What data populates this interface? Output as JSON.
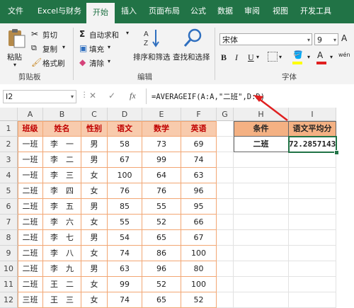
{
  "ribbon_tabs": [
    "文件",
    "Excel与财务",
    "开始",
    "插入",
    "页面布局",
    "公式",
    "数据",
    "审阅",
    "视图",
    "开发工具"
  ],
  "active_tab": "开始",
  "clipboard": {
    "paste": "粘贴",
    "cut": "剪切",
    "copy": "复制",
    "format_painter": "格式刷",
    "group": "剪贴板"
  },
  "editing": {
    "autosum": "自动求和",
    "fill": "填充",
    "clear": "清除",
    "sort_filter": "排序和筛选",
    "find_select": "查找和选择",
    "group": "编辑"
  },
  "font": {
    "name": "宋体",
    "size": "9",
    "bold": "B",
    "italic": "I",
    "underline": "U",
    "increase": "A",
    "decrease": "A",
    "font_color_glyph": "A",
    "phonetic": "wén",
    "group": "字体"
  },
  "formula_bar": {
    "name_box": "I2",
    "cancel": "✕",
    "confirm": "✓",
    "fx": "fx",
    "formula": "=AVERAGEIF(A:A,\"二班\",D:D)"
  },
  "columns": [
    "A",
    "B",
    "C",
    "D",
    "E",
    "F",
    "G",
    "H",
    "I"
  ],
  "rows": [
    "1",
    "2",
    "3",
    "4",
    "5",
    "6",
    "7",
    "8",
    "9",
    "10",
    "11",
    "12"
  ],
  "table": {
    "headers": [
      "班级",
      "姓名",
      "性别",
      "语文",
      "数学",
      "英语"
    ],
    "data": [
      [
        "一班",
        "李　一",
        "男",
        "58",
        "73",
        "69"
      ],
      [
        "一班",
        "李　二",
        "男",
        "67",
        "99",
        "74"
      ],
      [
        "一班",
        "李　三",
        "女",
        "100",
        "64",
        "63"
      ],
      [
        "二班",
        "李　四",
        "女",
        "76",
        "76",
        "96"
      ],
      [
        "二班",
        "李　五",
        "男",
        "85",
        "55",
        "95"
      ],
      [
        "二班",
        "李　六",
        "女",
        "55",
        "52",
        "66"
      ],
      [
        "二班",
        "李　七",
        "男",
        "54",
        "65",
        "67"
      ],
      [
        "二班",
        "李　八",
        "女",
        "74",
        "86",
        "100"
      ],
      [
        "二班",
        "李　九",
        "男",
        "63",
        "96",
        "80"
      ],
      [
        "二班",
        "王　二",
        "女",
        "99",
        "52",
        "100"
      ],
      [
        "三班",
        "王　三",
        "女",
        "74",
        "65",
        "52"
      ]
    ]
  },
  "criteria": {
    "h1": "条件",
    "i1": "语文平均分",
    "h2": "二班",
    "i2": "72.2857143"
  },
  "colors": {
    "excel_green": "#217346",
    "header_fill": "#f8cbad",
    "header_text": "#c00000",
    "criteria_fill": "#f4b183",
    "arrow": "#e02020"
  }
}
